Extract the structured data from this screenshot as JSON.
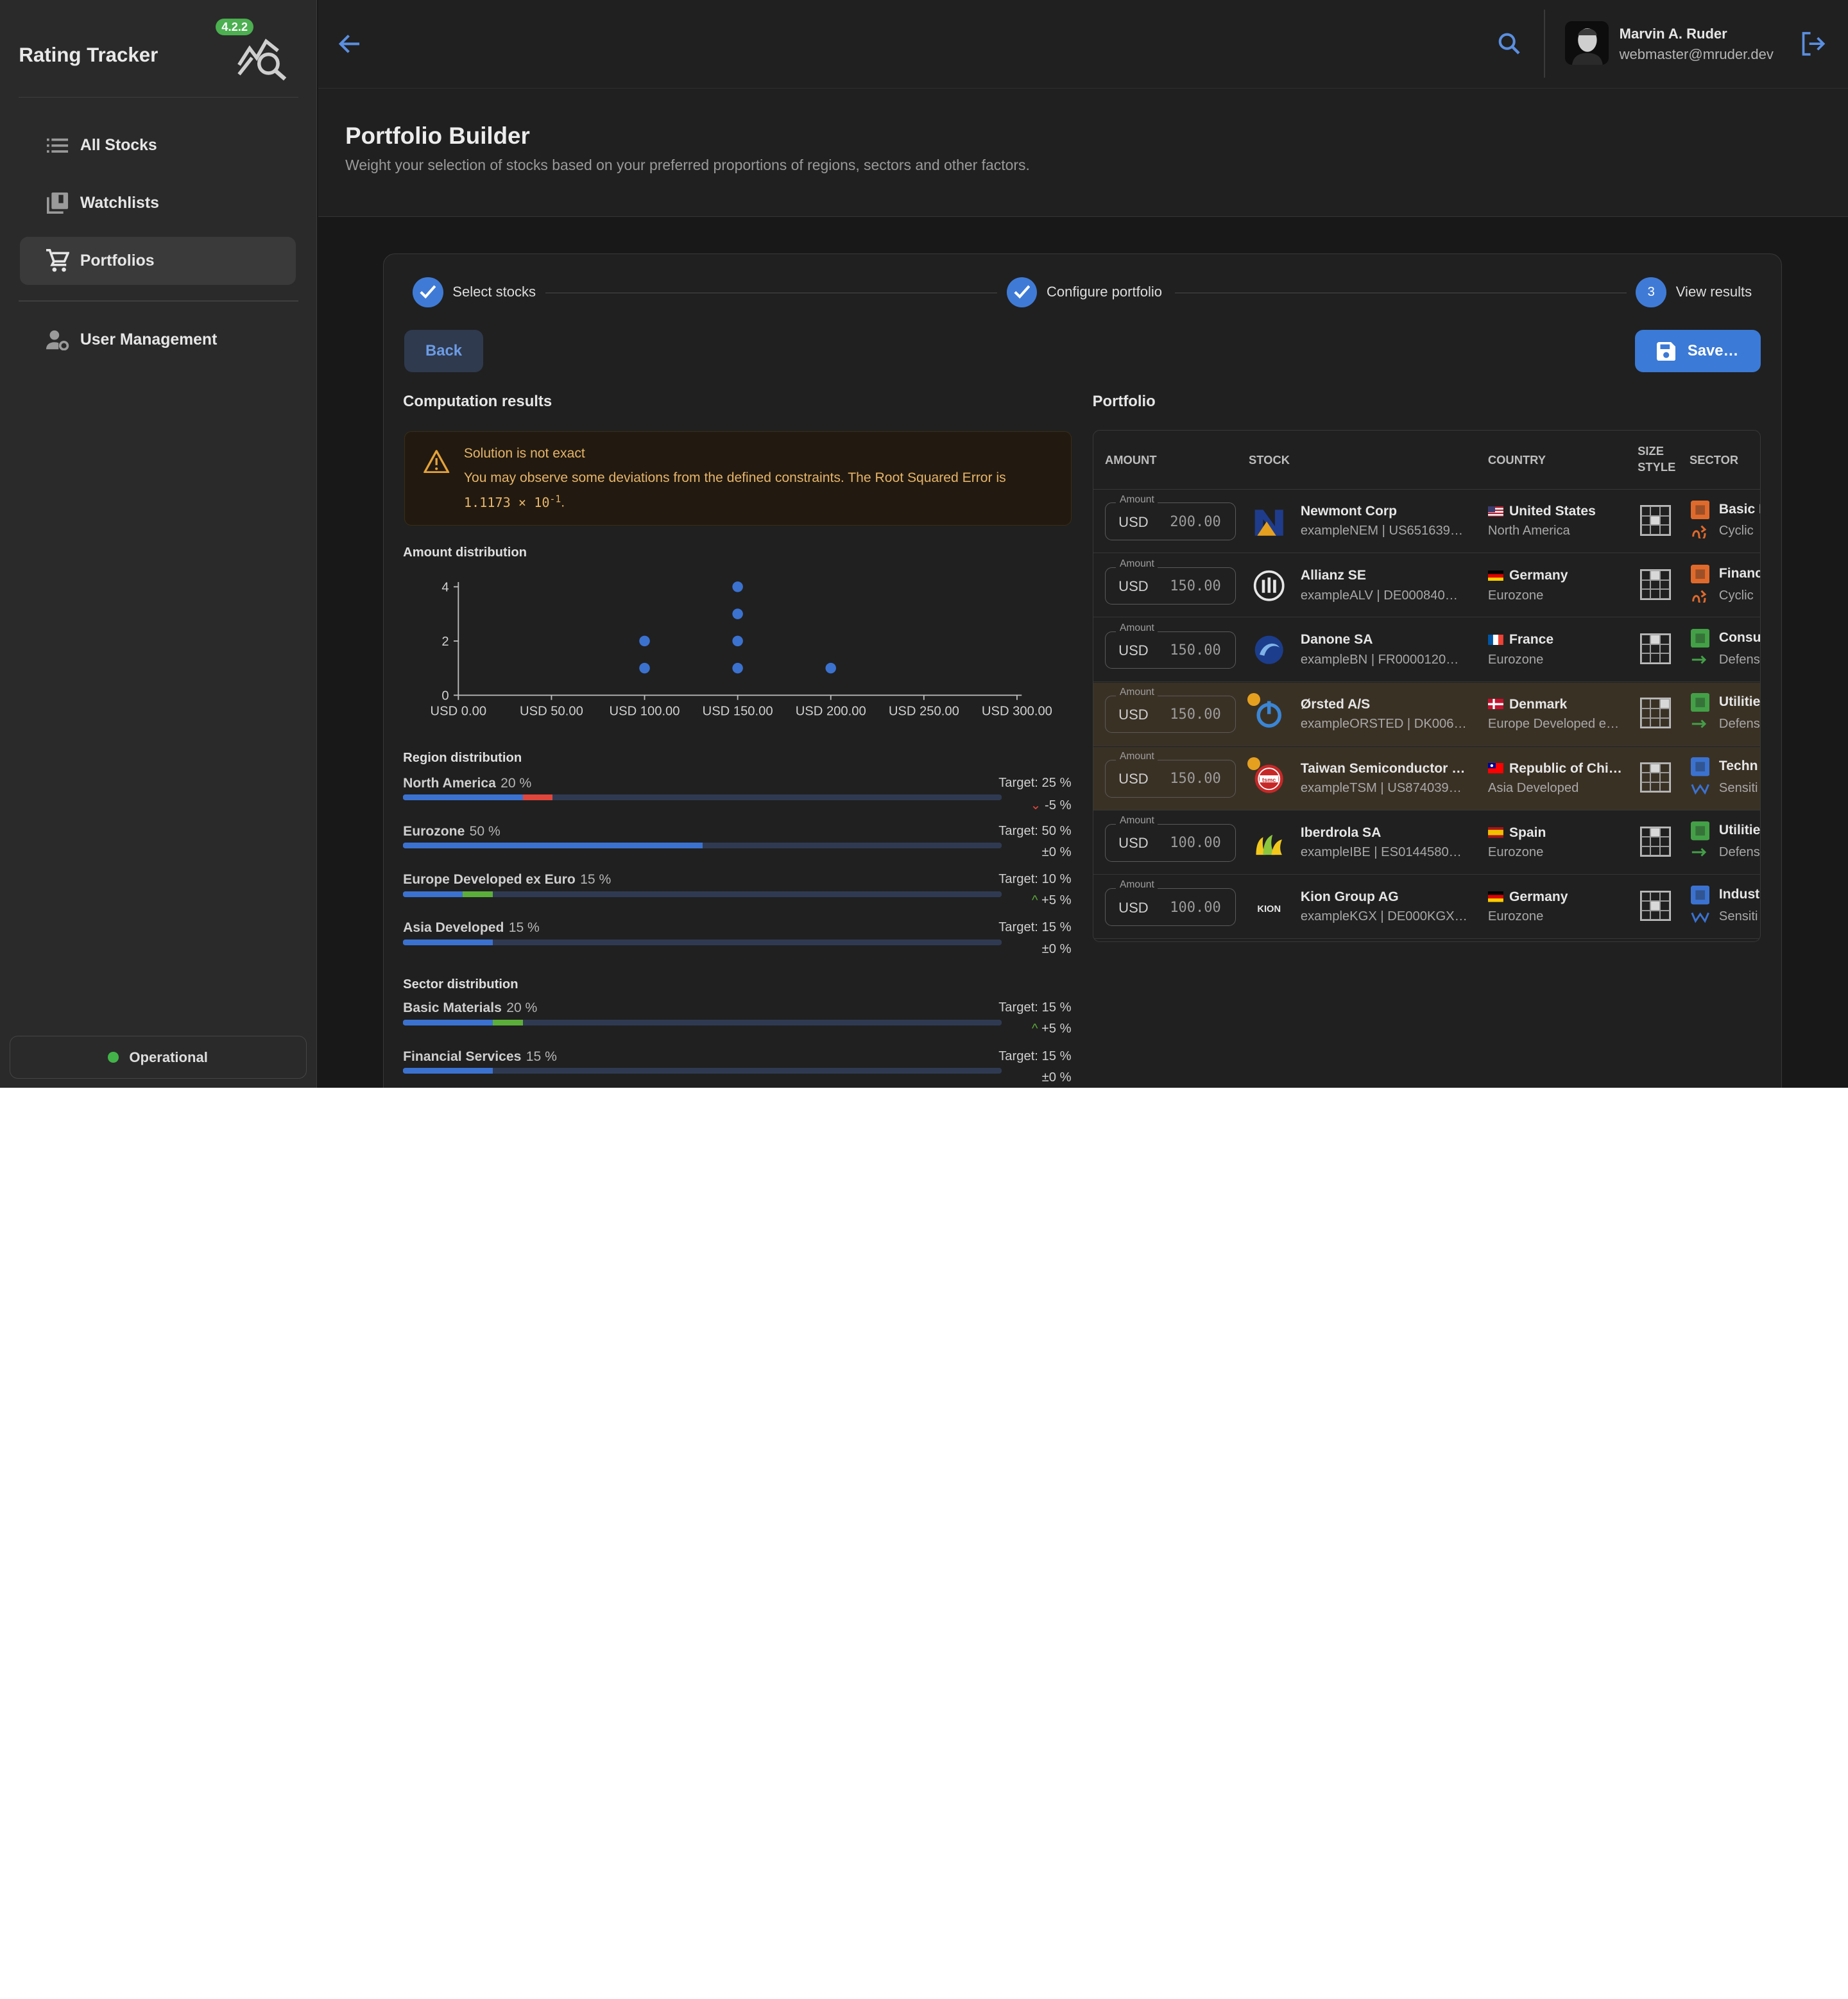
{
  "app": {
    "title": "Rating Tracker",
    "version": "4.2.2"
  },
  "sidebar": {
    "items": [
      {
        "label": "All Stocks",
        "icon": "list-icon"
      },
      {
        "label": "Watchlists",
        "icon": "library-icon"
      },
      {
        "label": "Portfolios",
        "icon": "cart-icon",
        "active": true
      },
      {
        "label": "User Management",
        "icon": "manage-accounts-icon"
      }
    ],
    "status": "Operational"
  },
  "user": {
    "name": "Marvin A. Ruder",
    "email": "webmaster@mruder.dev"
  },
  "page": {
    "title": "Portfolio Builder",
    "subtitle": "Weight your selection of stocks based on your preferred proportions of regions, sectors and other factors."
  },
  "stepper": {
    "steps": [
      {
        "label": "Select stocks",
        "done": true
      },
      {
        "label": "Configure portfolio",
        "done": true
      },
      {
        "label": "View results",
        "number": "3"
      }
    ]
  },
  "buttons": {
    "back": "Back",
    "save": "Save…"
  },
  "results": {
    "title": "Computation results",
    "warning": {
      "title": "Solution is not exact",
      "text": "You may observe some deviations from the defined constraints. The Root Squared Error is",
      "value": "1.1173",
      "times": "×",
      "base": "10",
      "exp": "-1",
      "end": "."
    },
    "amount_title": "Amount distribution",
    "region_title": "Region distribution",
    "sector_title": "Sector distribution",
    "regions": [
      {
        "name": "North America",
        "pct": "20 %",
        "target": "Target: 25 %",
        "delta": "-5 %",
        "actual": 20,
        "goal": 25,
        "dir": "down"
      },
      {
        "name": "Eurozone",
        "pct": "50 %",
        "target": "Target: 50 %",
        "delta": "±0 %",
        "actual": 50,
        "goal": 50,
        "dir": "eq"
      },
      {
        "name": "Europe Developed ex Euro",
        "pct": "15 %",
        "target": "Target: 10 %",
        "delta": "+5 %",
        "actual": 15,
        "goal": 10,
        "dir": "up"
      },
      {
        "name": "Asia Developed",
        "pct": "15 %",
        "target": "Target: 15 %",
        "delta": "±0 %",
        "actual": 15,
        "goal": 15,
        "dir": "eq"
      }
    ],
    "sectors": [
      {
        "name": "Basic Materials",
        "pct": "20 %",
        "target": "Target: 15 %",
        "delta": "+5 %",
        "actual": 20,
        "goal": 15,
        "dir": "up"
      },
      {
        "name": "Financial Services",
        "pct": "15 %",
        "target": "Target: 15 %",
        "delta": "±0 %",
        "actual": 15,
        "goal": 15,
        "dir": "eq"
      }
    ]
  },
  "chart_data": {
    "type": "scatter",
    "x_ticks": [
      "USD 0.00",
      "USD 50.00",
      "USD 100.00",
      "USD 150.00",
      "USD 200.00",
      "USD 250.00",
      "USD 300.00"
    ],
    "y_ticks": [
      "0",
      "2",
      "4"
    ],
    "xlim": [
      0,
      300
    ],
    "ylim": [
      0,
      4
    ],
    "points": [
      {
        "x": 100,
        "y": 1
      },
      {
        "x": 100,
        "y": 2
      },
      {
        "x": 150,
        "y": 1
      },
      {
        "x": 150,
        "y": 2
      },
      {
        "x": 150,
        "y": 3
      },
      {
        "x": 150,
        "y": 4
      },
      {
        "x": 200,
        "y": 1
      }
    ],
    "color": "#3b72d0"
  },
  "portfolio": {
    "title": "Portfolio",
    "columns": {
      "amount": "AMOUNT",
      "stock": "STOCK",
      "country": "COUNTRY",
      "size": "SIZE",
      "style": "STYLE",
      "sector": "SECTOR"
    },
    "amount_label": "Amount",
    "currency": "USD",
    "rows": [
      {
        "amount": "200.00",
        "name": "Newmont Corp",
        "sub": "exampleNEM | US651639…",
        "country": "United States",
        "region": "North America",
        "flag": "us",
        "sector": "Basic M",
        "super": "Cyclic",
        "logo": "newmont-logo",
        "hl": false,
        "size": 4,
        "sc": "#e06a2c",
        "trend": "cyclical"
      },
      {
        "amount": "150.00",
        "name": "Allianz SE",
        "sub": "exampleALV | DE000840…",
        "country": "Germany",
        "region": "Eurozone",
        "flag": "de",
        "sector": "Financ",
        "super": "Cyclic",
        "logo": "allianz-logo",
        "hl": false,
        "size": 1,
        "sc": "#e06a2c",
        "trend": "cyclical"
      },
      {
        "amount": "150.00",
        "name": "Danone SA",
        "sub": "exampleBN | FR0000120…",
        "country": "France",
        "region": "Eurozone",
        "flag": "fr",
        "sector": "Consu",
        "super": "Defens",
        "logo": "danone-logo",
        "hl": false,
        "size": 1,
        "sc": "#43a047",
        "trend": "defensive"
      },
      {
        "amount": "150.00",
        "name": "Ørsted A/S",
        "sub": "exampleORSTED | DK006…",
        "country": "Denmark",
        "region": "Europe Developed e…",
        "flag": "dk",
        "sector": "Utilitie",
        "super": "Defens",
        "logo": "orsted-logo",
        "hl": true,
        "size": 2,
        "sc": "#43a047",
        "trend": "defensive"
      },
      {
        "amount": "150.00",
        "name": "Taiwan Semiconductor …",
        "sub": "exampleTSM | US874039…",
        "country": "Republic of Chi…",
        "region": "Asia Developed",
        "flag": "tw",
        "sector": "Techn",
        "super": "Sensiti",
        "logo": "tsmc-logo",
        "hl": true,
        "size": 1,
        "sc": "#3b72d0",
        "trend": "sensitive"
      },
      {
        "amount": "100.00",
        "name": "Iberdrola SA",
        "sub": "exampleIBE | ES0144580…",
        "country": "Spain",
        "region": "Eurozone",
        "flag": "es",
        "sector": "Utilitie",
        "super": "Defens",
        "logo": "iberdrola-logo",
        "hl": false,
        "size": 1,
        "sc": "#43a047",
        "trend": "defensive"
      },
      {
        "amount": "100.00",
        "name": "Kion Group AG",
        "sub": "exampleKGX | DE000KGX…",
        "country": "Germany",
        "region": "Eurozone",
        "flag": "de",
        "sector": "Indust",
        "super": "Sensiti",
        "logo": "kion-logo",
        "hl": false,
        "size": 4,
        "sc": "#3b72d0",
        "trend": "sensitive"
      }
    ]
  }
}
